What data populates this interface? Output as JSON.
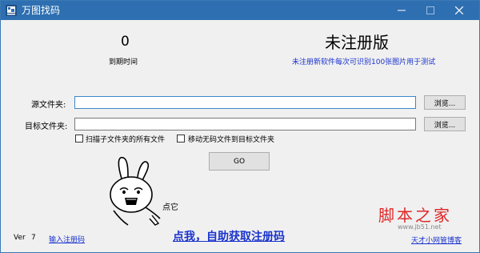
{
  "window": {
    "title": "万图找码",
    "icon": "app-icon",
    "controls": [
      "minimize-icon",
      "maximize-icon",
      "close-icon"
    ]
  },
  "header": {
    "countdown_value": "0",
    "countdown_label": "到期时间",
    "unregistered_title": "未注册版",
    "unregistered_note": "未注册新软件每次可识别100张图片用于测试"
  },
  "form": {
    "source_label": "源文件夹:",
    "source_value": "",
    "target_label": "目标文件夹:",
    "target_value": "",
    "browse_label": "浏览...",
    "scan_subfolders_label": "扫描子文件夹的所有文件",
    "scan_subfolders_checked": false,
    "move_nocode_label": "移动无码文件到目标文件夹",
    "move_nocode_checked": false,
    "go_label": "GO"
  },
  "mascot": {
    "caption": "点它"
  },
  "footer": {
    "version_label": "Ver",
    "version_number": "7",
    "enter_code_link": "输入注册码",
    "promo_link": "点我，自助获取注册码",
    "blog_link": "天才小网管博客"
  },
  "watermark": {
    "text": "脚本之家",
    "url": "www.jb51.net"
  },
  "colors": {
    "titlebar": "#2e6fb1",
    "link_blue": "#1a33cc",
    "watermark_red": "#e02828"
  }
}
